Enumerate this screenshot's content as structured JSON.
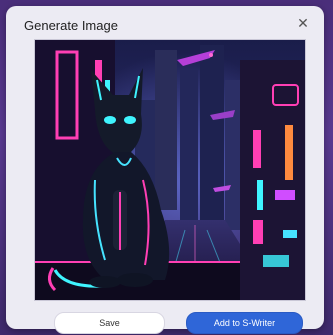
{
  "dialog": {
    "title": "Generate Image",
    "close_icon": "close-icon",
    "image_icon": "generated-cyberpunk-cat-image"
  },
  "actions": {
    "save_label": "Save",
    "add_label": "Add to S-Writer"
  },
  "colors": {
    "dialog_bg": "#ecebf3",
    "primary_button": "#2f66d8",
    "neon_cyan": "#3ff4ff",
    "neon_pink": "#ff3fb4"
  }
}
